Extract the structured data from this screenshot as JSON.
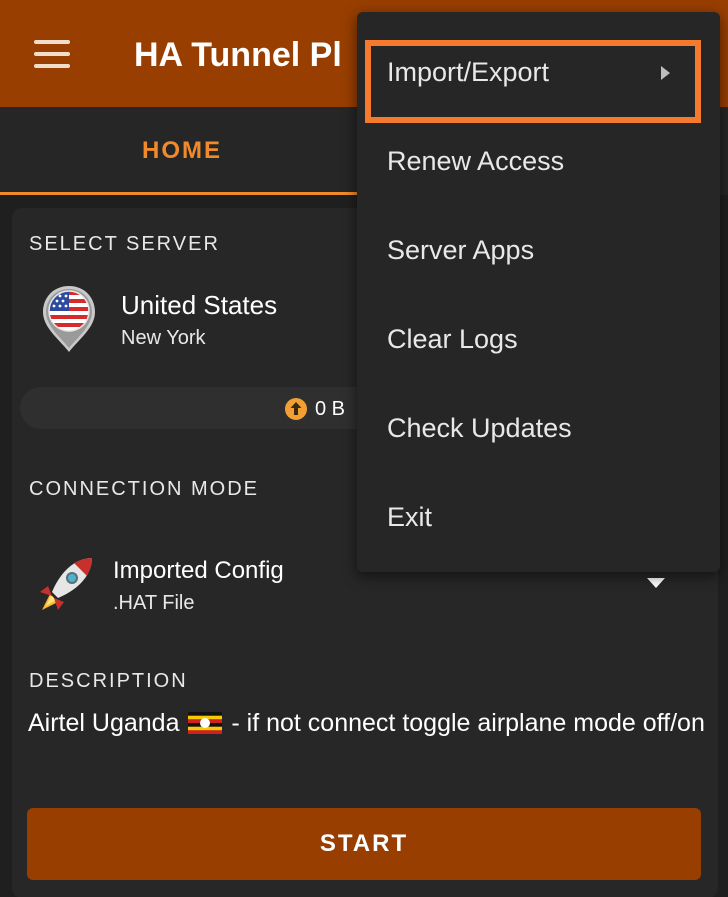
{
  "appbar": {
    "title": "HA Tunnel Pl",
    "menu_icon": "hamburger-menu-icon"
  },
  "tabs": [
    {
      "label": "HOME",
      "active": true
    }
  ],
  "server": {
    "section_label": "SELECT SERVER",
    "country": "United States",
    "city": "New York",
    "icon": "us-flag-pin-icon"
  },
  "stats": {
    "upload": "0 B",
    "icon": "upload-arrow-icon"
  },
  "connection": {
    "section_label": "CONNECTION MODE",
    "mode": "Imported Config",
    "sub": ".HAT File",
    "icon": "rocket-icon"
  },
  "description": {
    "section_label": "DESCRIPTION",
    "text_before": "Airtel Uganda",
    "text_after": "- if not connect toggle airplane mode off/on",
    "flag_icon": "uganda-flag-icon"
  },
  "start_button": {
    "label": "START"
  },
  "overflow_menu": {
    "items": [
      {
        "label": "Import/Export",
        "has_submenu": true
      },
      {
        "label": "Renew Access"
      },
      {
        "label": "Server Apps"
      },
      {
        "label": "Clear Logs"
      },
      {
        "label": "Check Updates"
      },
      {
        "label": "Exit"
      }
    ]
  },
  "colors": {
    "primary": "#983e00",
    "accent": "#f08a2a",
    "highlight_outline": "#f57a2e",
    "background": "#1f1f1f",
    "card": "#272727",
    "menu": "#262626"
  }
}
